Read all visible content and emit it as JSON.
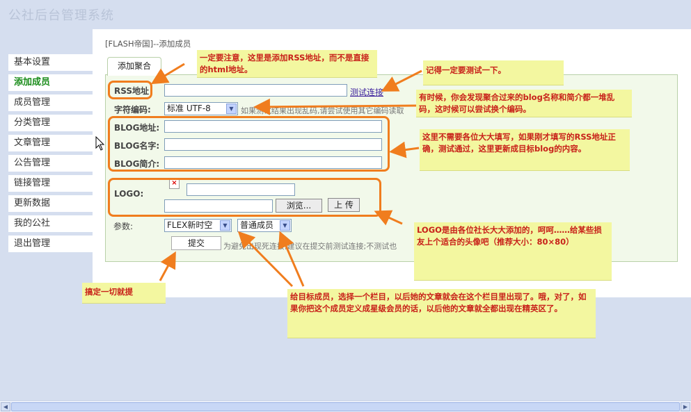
{
  "app_title": "公社后台管理系统",
  "sidebar": {
    "items": [
      {
        "label": "基本设置",
        "active": false
      },
      {
        "label": "添加成员",
        "active": true
      },
      {
        "label": "成员管理",
        "active": false
      },
      {
        "label": "分类管理",
        "active": false
      },
      {
        "label": "文章管理",
        "active": false
      },
      {
        "label": "公告管理",
        "active": false
      },
      {
        "label": "链接管理",
        "active": false
      },
      {
        "label": "更新数据",
        "active": false
      },
      {
        "label": "我的公社",
        "active": false
      },
      {
        "label": "退出管理",
        "active": false
      }
    ]
  },
  "breadcrumb": "[FLASH帝国]--添加成员",
  "tab_label": "添加聚合",
  "form": {
    "rss_label": "RSS地址",
    "test_link": "测试连接",
    "charset_label": "字符编码:",
    "charset_value": "标准 UTF-8",
    "charset_hint": "如果测试结果出现乱码,请尝试使用其它编码读取",
    "blog_addr_label": "BLOG地址:",
    "blog_name_label": "BLOG名字:",
    "blog_desc_label": "BLOG简介:",
    "logo_label": "LOGO:",
    "browse_button": "浏览...",
    "upload_button": "上 传",
    "params_label": "参数:",
    "category_value": "FLEX新时空",
    "member_type_value": "普通成员",
    "submit_button": "提交",
    "submit_hint": "为避免出现死连接,建议在提交前测试连接;不测试也"
  },
  "notes": {
    "rss_note": "一定要注意，这里是添加RSS地址，而不是直接的html地址。",
    "test_note": "记得一定要测试一下。",
    "charset_note": "有时候，你会发现聚合过来的blog名称和简介都一堆乱码，这时候可以尝试换个编码。",
    "blog_note": "这里不需要各位大大填写，如果刚才填写的RSS地址正确，测试通过，这里更新成目标blog的内容。",
    "logo_note": "LOGO是由各位社长大大添加的，呵呵……给某些损友上个适合的头像吧（推荐大小：80×80）",
    "submit_note": "搞定一切就提",
    "category_note": "给目标成员，选择一个栏目，以后她的文章就会在这个栏目里出现了。哦，对了，如果你把这个成员定义成星级会员的话，以后他的文章就全都出现在精英区了。"
  },
  "colors": {
    "accent_orange": "#f07d1e",
    "note_bg": "#f3f7a0",
    "note_text": "#c8221a",
    "active_nav": "#1a8c1a"
  }
}
